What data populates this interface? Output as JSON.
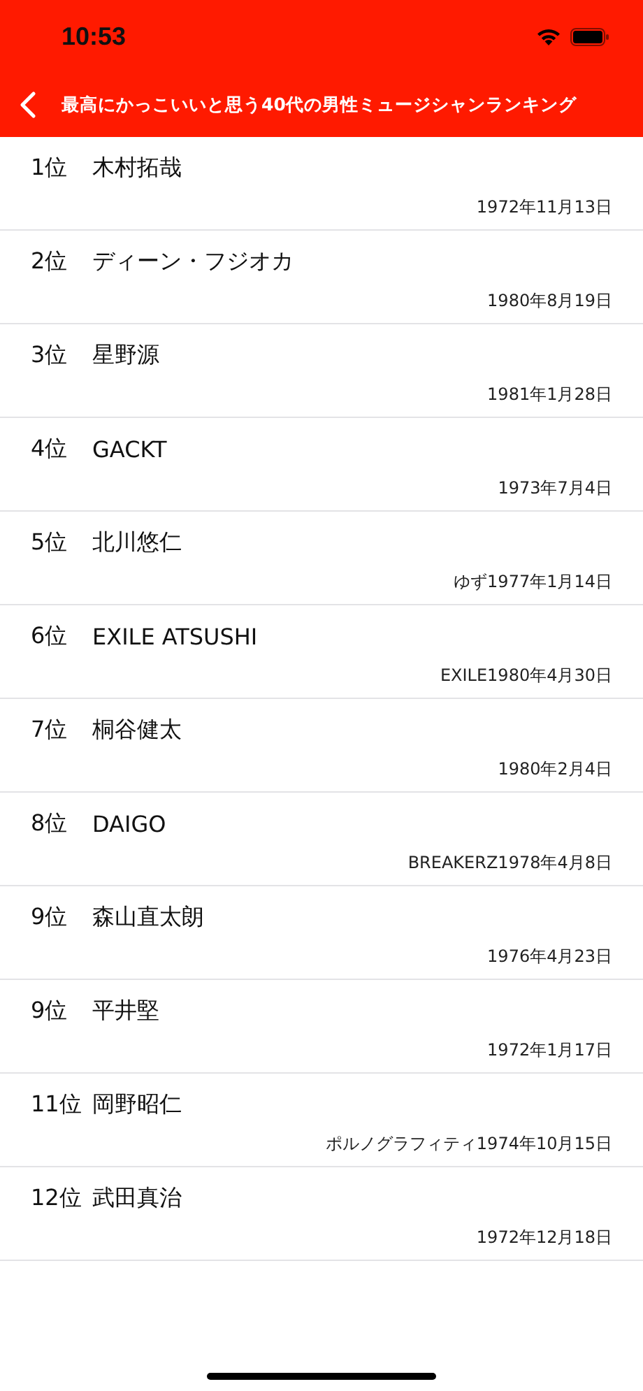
{
  "status_bar": {
    "time": "10:53"
  },
  "nav": {
    "title": "最高にかっこいいと思う40代の男性ミュージシャンランキング"
  },
  "rows": [
    {
      "rank": "1位",
      "name": "木村拓哉",
      "detail": "1972年11月13日"
    },
    {
      "rank": "2位",
      "name": "ディーン・フジオカ",
      "detail": "1980年8月19日"
    },
    {
      "rank": "3位",
      "name": "星野源",
      "detail": "1981年1月28日"
    },
    {
      "rank": "4位",
      "name": "GACKT",
      "detail": "1973年7月4日"
    },
    {
      "rank": "5位",
      "name": "北川悠仁",
      "detail": "ゆず1977年1月14日"
    },
    {
      "rank": "6位",
      "name": "EXILE ATSUSHI",
      "detail": "EXILE1980年4月30日"
    },
    {
      "rank": "7位",
      "name": "桐谷健太",
      "detail": "1980年2月4日"
    },
    {
      "rank": "8位",
      "name": "DAIGO",
      "detail": "BREAKERZ1978年4月8日"
    },
    {
      "rank": "9位",
      "name": "森山直太朗",
      "detail": "1976年4月23日"
    },
    {
      "rank": "9位",
      "name": "平井堅",
      "detail": "1972年1月17日"
    },
    {
      "rank": "11位",
      "name": "岡野昭仁",
      "detail": "ポルノグラフィティ1974年10月15日"
    },
    {
      "rank": "12位",
      "name": "武田真治",
      "detail": "1972年12月18日"
    }
  ]
}
